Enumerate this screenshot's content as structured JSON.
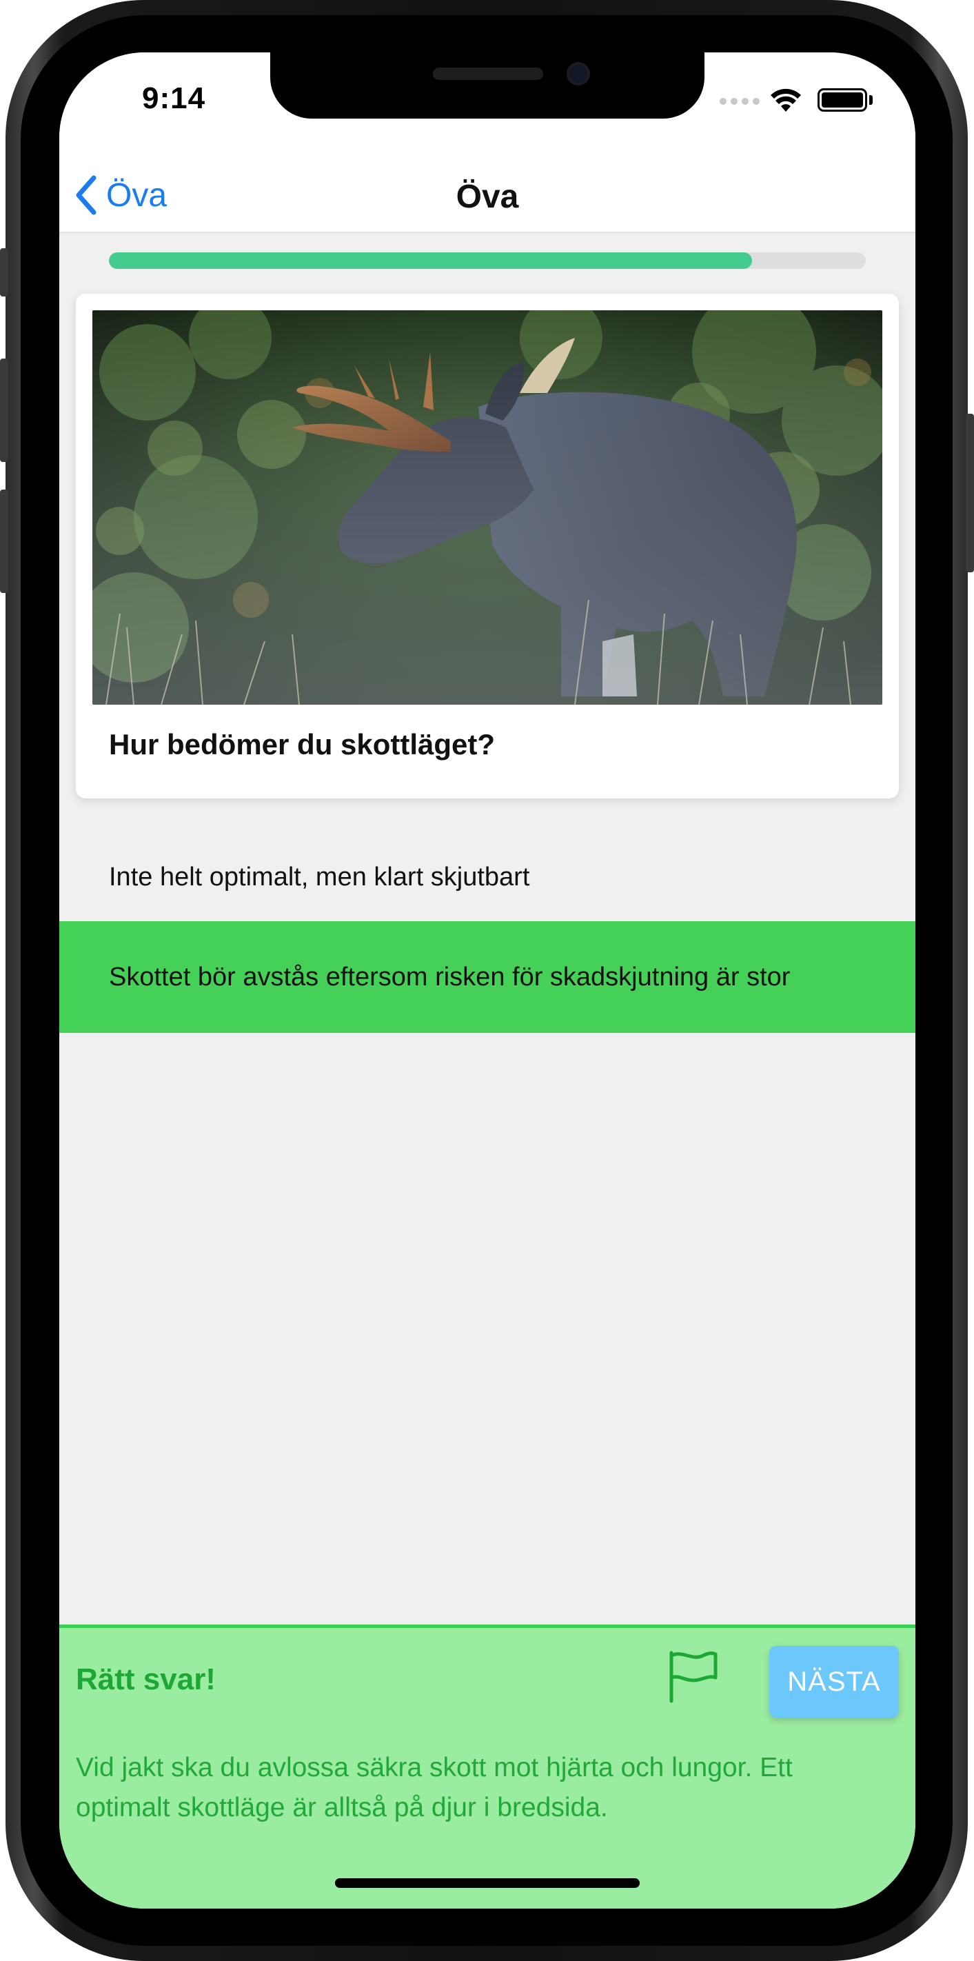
{
  "status_bar": {
    "time": "9:14",
    "wifi_icon": "wifi-icon",
    "battery_icon": "battery-full-icon"
  },
  "navbar": {
    "back_label": "Öva",
    "title": "Öva",
    "back_icon": "chevron-left-icon"
  },
  "progress": {
    "value": 0.85,
    "color": "#44cc8e"
  },
  "question_card": {
    "image_alt": "moose-photo",
    "question": "Hur bedömer du skottläget?"
  },
  "answers": [
    {
      "text": "Inte helt optimalt, men klart skjutbart",
      "selected": false
    },
    {
      "text": "Skottet bör avstås eftersom risken för skadskjutning är stor",
      "selected": true,
      "highlight_color": "#45d158"
    }
  ],
  "feedback": {
    "title": "Rätt svar!",
    "flag_icon": "flag-icon",
    "next_label": "NÄSTA",
    "explanation": "Vid jakt ska du avlossa säkra skott mot hjärta och lungor. Ett optimalt skottläge är alltså på djur i bredsida.",
    "background": "#9aeca1",
    "text_color": "#22a83a"
  }
}
